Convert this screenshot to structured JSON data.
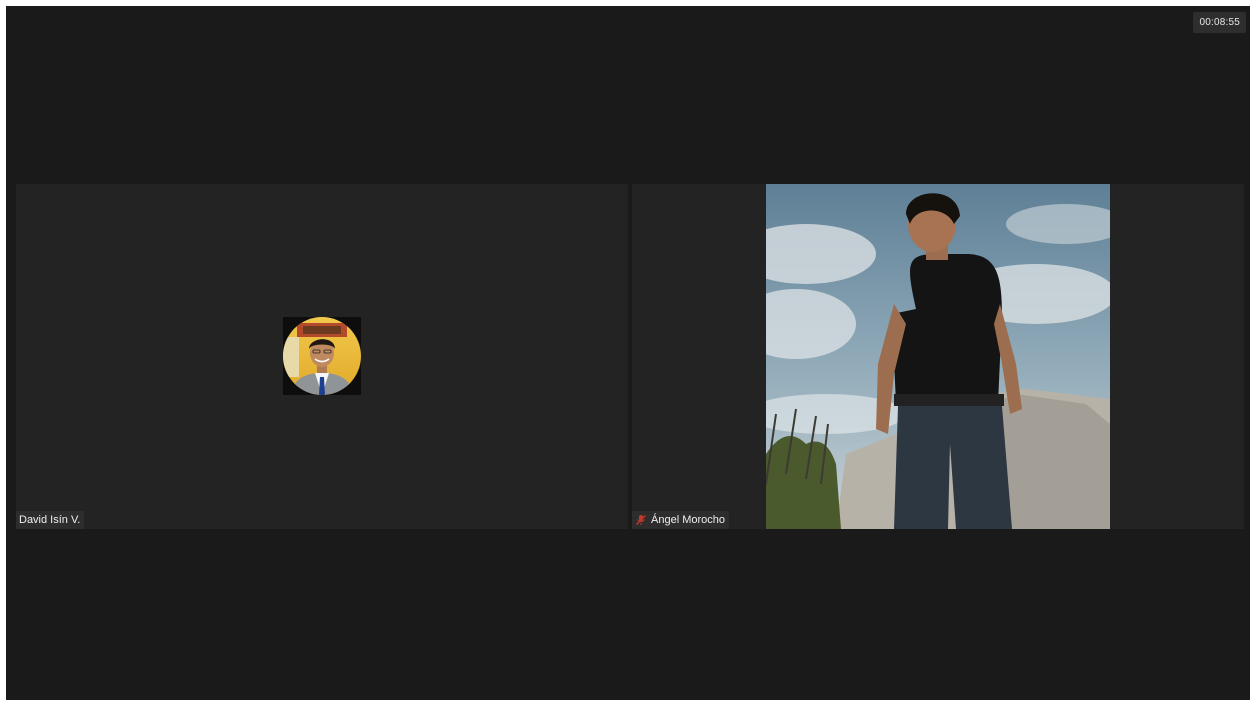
{
  "call": {
    "duration": "00:08:55"
  },
  "participants": [
    {
      "name": "David Isín V.",
      "video": "off",
      "avatar_icon": "profile-photo-avatar",
      "muted": false
    },
    {
      "name": "Ángel Morocho",
      "video": "on",
      "muted": true,
      "status_icon": "muted-mic-icon"
    }
  ],
  "colors": {
    "background": "#1a1a1a",
    "tile": "#232323",
    "muted_red": "#c0392b"
  }
}
